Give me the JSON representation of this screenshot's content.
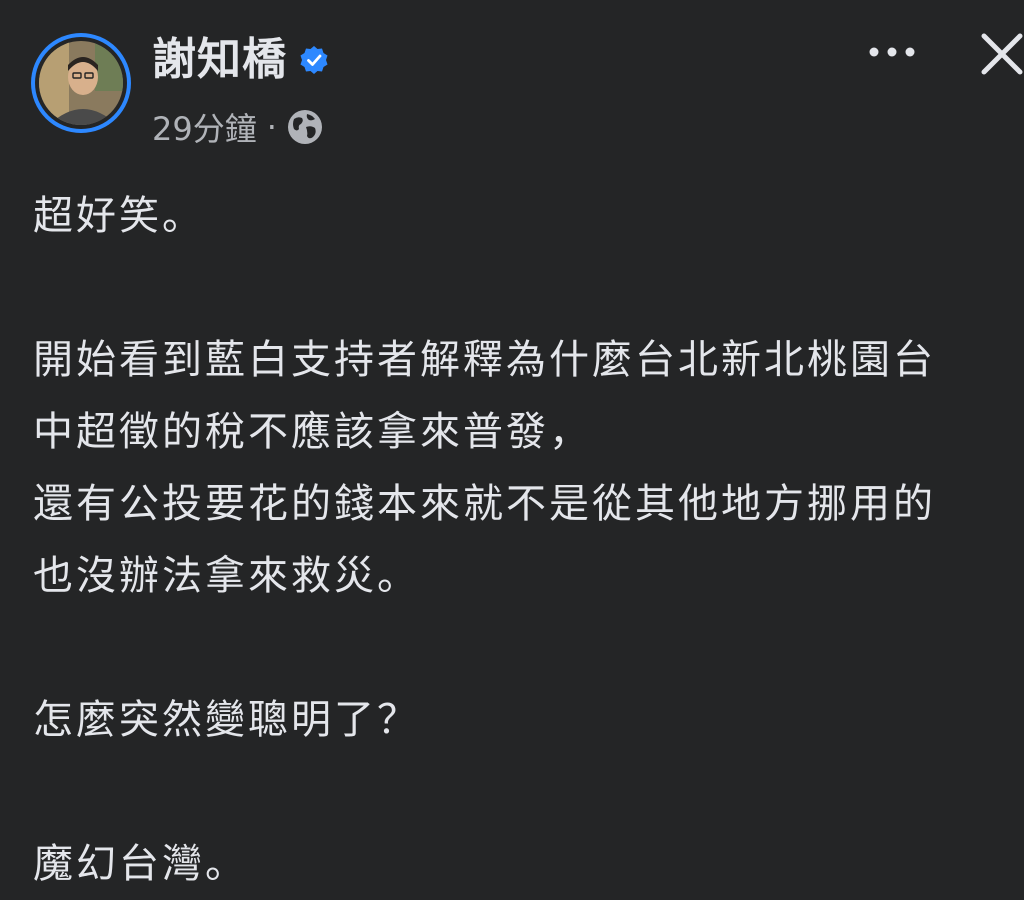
{
  "post": {
    "author": "謝知橋",
    "verified": true,
    "time": "29分鐘",
    "separator": "·",
    "audience_icon": "globe-icon",
    "paragraphs": [
      "超好笑。",
      "開始看到藍白支持者解釋為什麼台北新北桃園台\n中超徵的稅不應該拿來普發，\n還有公投要花的錢本來就不是從其他地方挪用的\n也沒辦法拿來救災。",
      "怎麼突然變聰明了？",
      "魔幻台灣。"
    ]
  },
  "icons": {
    "more": "more-horizontal-icon",
    "close": "close-icon",
    "verified": "verified-badge-icon"
  },
  "colors": {
    "background": "#242526",
    "primary_text": "#e4e6eb",
    "secondary_text": "#b0b3b8",
    "accent": "#2d88ff"
  }
}
